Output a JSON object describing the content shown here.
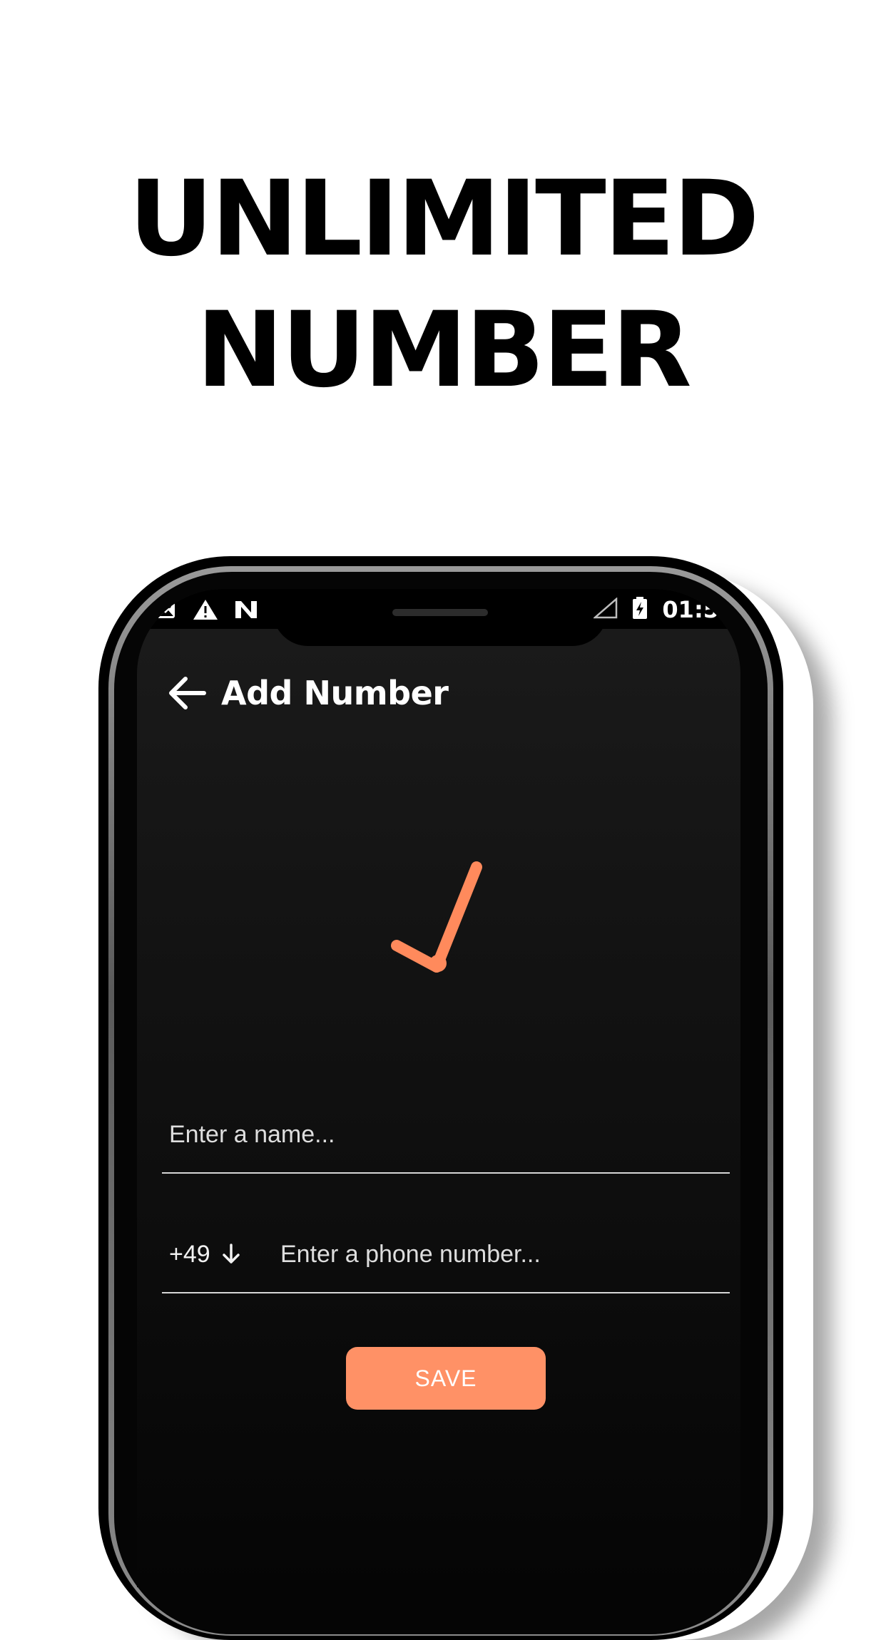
{
  "headline": {
    "line1": "UNLIMITED",
    "line2": "NUMBER"
  },
  "status_bar": {
    "time": "01:5",
    "icons_left": [
      "landscape-notification-icon",
      "warning-icon",
      "n-notification-icon"
    ],
    "icons_right": [
      "signal-icon",
      "battery-charging-icon"
    ]
  },
  "app_bar": {
    "back_icon": "arrow-left-icon",
    "title": "Add Number"
  },
  "illustration": {
    "icon": "clock-hands-icon",
    "color": "#ff8a5c"
  },
  "form": {
    "name_placeholder": "Enter a name...",
    "country_code": "+49",
    "country_code_icon": "arrow-down-icon",
    "phone_placeholder": "Enter a phone number...",
    "save_label": "SAVE"
  },
  "colors": {
    "accent": "#ff9166",
    "screen_background": "#131313",
    "text_primary": "#ffffff"
  }
}
